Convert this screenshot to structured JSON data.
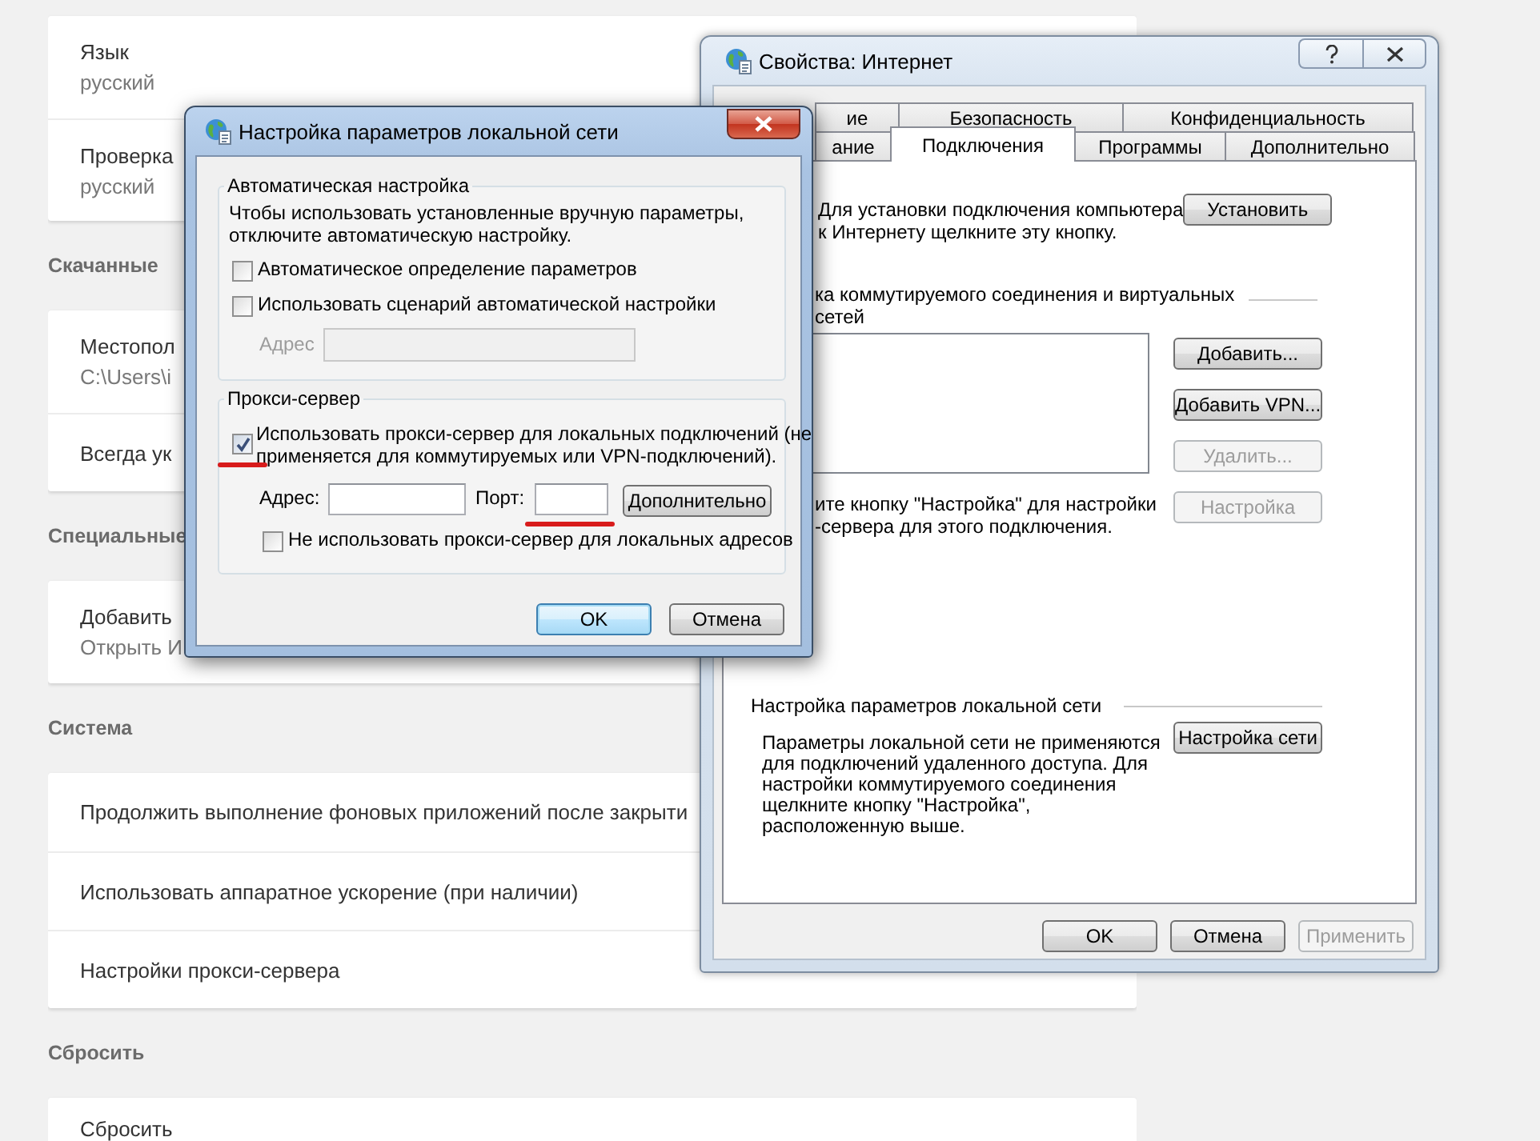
{
  "settings": {
    "sections": [
      {
        "items": [
          {
            "title": "Язык",
            "subtitle": "русский"
          },
          {
            "title": "Проверка",
            "subtitle": "русский"
          }
        ]
      },
      {
        "heading": "Скачанные",
        "items": [
          {
            "title": "Местопол",
            "subtitle": "C:\\Users\\i"
          },
          {
            "title": "Всегда ук"
          }
        ]
      },
      {
        "heading": "Специальные",
        "items": [
          {
            "title": "Добавить",
            "subtitle": "Открыть И"
          }
        ]
      },
      {
        "heading": "Система",
        "items": [
          {
            "title": "Продолжить выполнение фоновых приложений после закрыти"
          },
          {
            "title": "Использовать аппаратное ускорение (при наличии)"
          },
          {
            "title": "Настройки прокси-сервера"
          }
        ]
      },
      {
        "heading": "Сбросить",
        "items": [
          {
            "title": "Сбросить"
          }
        ]
      }
    ]
  },
  "internet_properties": {
    "title": "Свойства: Интернет",
    "tab_rows": [
      {
        "tabs": [
          {
            "label": "ие",
            "selected": false
          },
          {
            "label": "Безопасность",
            "selected": false
          },
          {
            "label": "Конфиденциальность",
            "selected": false
          }
        ]
      },
      {
        "tabs": [
          {
            "label": "ание",
            "selected": false
          },
          {
            "label": "Подключения",
            "selected": true
          },
          {
            "label": "Программы",
            "selected": false
          },
          {
            "label": "Дополнительно",
            "selected": false
          }
        ]
      }
    ],
    "setup": {
      "text": [
        "Для установки подключения компьютера",
        "к Интернету щелкните эту кнопку."
      ],
      "button": {
        "label": "Установить",
        "disabled": false
      }
    },
    "dialup": {
      "heading": [
        "ка коммутируемого соединения и виртуальных",
        "сетей"
      ],
      "buttons": [
        {
          "label": "Добавить...",
          "disabled": false
        },
        {
          "label": "Добавить VPN...",
          "disabled": false
        },
        {
          "label": "Удалить...",
          "disabled": true
        },
        {
          "label": "Настройка",
          "disabled": true
        }
      ],
      "hint": [
        "ите кнопку \"Настройка\" для настройки",
        "-сервера для этого подключения."
      ]
    },
    "lan": {
      "heading": "Настройка параметров локальной сети",
      "text": [
        "Параметры локальной сети не применяются",
        "для подключений удаленного доступа. Для",
        "настройки коммутируемого соединения",
        "щелкните кнопку \"Настройка\",",
        "расположенную выше."
      ],
      "button": {
        "label": "Настройка сети",
        "disabled": false
      }
    },
    "footer_buttons": [
      {
        "label": "OK",
        "disabled": false
      },
      {
        "label": "Отмена",
        "disabled": false
      },
      {
        "label": "Применить",
        "disabled": true
      }
    ]
  },
  "lan_dialog": {
    "title": "Настройка параметров локальной сети",
    "auto": {
      "heading": "Автоматическая настройка",
      "text": [
        "Чтобы использовать установленные вручную параметры,",
        "отключите автоматическую настройку."
      ],
      "options": [
        {
          "label": "Автоматическое определение параметров",
          "checked": false
        },
        {
          "label": "Использовать сценарий автоматической настройки",
          "checked": false
        }
      ],
      "address": {
        "label": "Адрес",
        "disabled": true
      }
    },
    "proxy": {
      "heading": "Прокси-сервер",
      "use_proxy": {
        "label": [
          "Использовать прокси-сервер для локальных подключений (не",
          "применяется для коммутируемых или VPN-подключений)."
        ],
        "checked": true,
        "underlined": true
      },
      "address_label": "Адрес:",
      "port": {
        "label": "Порт:",
        "underlined": true
      },
      "advanced_button": "Дополнительно",
      "bypass": {
        "label": "Не использовать прокси-сервер для локальных адресов",
        "checked": false
      }
    },
    "buttons": [
      {
        "label": "OK",
        "default": true
      },
      {
        "label": "Отмена",
        "default": false
      }
    ]
  }
}
